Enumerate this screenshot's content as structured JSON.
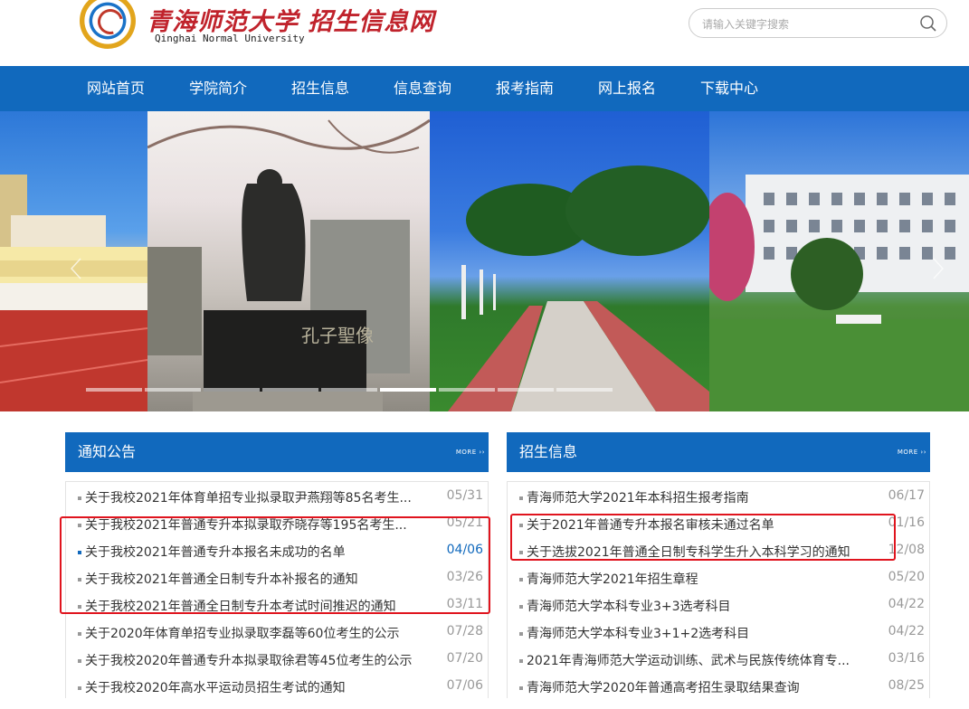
{
  "header": {
    "logo_cn": "青海师范大学 招生信息网",
    "logo_en": "Qinghai Normal University",
    "search_placeholder": "请输入关键字搜索"
  },
  "nav": [
    "网站首页",
    "学院简介",
    "招生信息",
    "信息查询",
    "报考指南",
    "网上报名",
    "下载中心"
  ],
  "notice": {
    "title": "通知公告",
    "more": "MORE ››",
    "items": [
      {
        "text": "关于我校2021年体育单招专业拟录取尹燕翔等85名考生...",
        "date": "05/31"
      },
      {
        "text": "关于我校2021年普通专升本拟录取乔晓存等195名考生...",
        "date": "05/21"
      },
      {
        "text": "关于我校2021年普通专升本报名未成功的名单",
        "date": "04/06"
      },
      {
        "text": "关于我校2021年普通全日制专升本补报名的通知",
        "date": "03/26"
      },
      {
        "text": "关于我校2021年普通全日制专升本考试时间推迟的通知",
        "date": "03/11"
      },
      {
        "text": "关于2020年体育单招专业拟录取李磊等60位考生的公示",
        "date": "07/28"
      },
      {
        "text": "关于我校2020年普通专升本拟录取徐君等45位考生的公示",
        "date": "07/20"
      },
      {
        "text": "关于我校2020年高水平运动员招生考试的通知",
        "date": "07/06"
      }
    ]
  },
  "admission": {
    "title": "招生信息",
    "more": "MORE ››",
    "items": [
      {
        "text": "青海师范大学2021年本科招生报考指南",
        "date": "06/17"
      },
      {
        "text": "关于2021年普通专升本报名审核未通过名单",
        "date": "01/16"
      },
      {
        "text": "关于选拔2021年普通全日制专科学生升入本科学习的通知",
        "date": "12/08"
      },
      {
        "text": "青海师范大学2021年招生章程",
        "date": "05/20"
      },
      {
        "text": "青海师范大学本科专业3+3选考科目",
        "date": "04/22"
      },
      {
        "text": "青海师范大学本科专业3+1+2选考科目",
        "date": "04/22"
      },
      {
        "text": "2021年青海师范大学运动训练、武术与民族传统体育专...",
        "date": "03/16"
      },
      {
        "text": "青海师范大学2020年普通高考招生录取结果查询",
        "date": "08/25"
      }
    ]
  },
  "colors": {
    "brand": "#1169bd",
    "highlight": "#e0141e",
    "logo_red": "#c0232c"
  }
}
